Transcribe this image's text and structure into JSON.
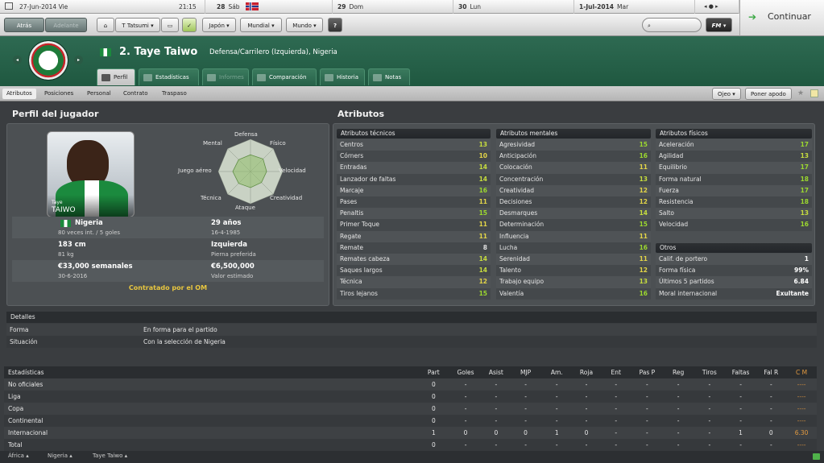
{
  "date_bar": {
    "current_date": "27-Jun-2014 Vie",
    "time": "21:15",
    "d1_day": "28",
    "d1_name": "Sáb",
    "d2_day": "29",
    "d2_name": "Dom",
    "d3_day": "30",
    "d3_name": "Lun",
    "d4_day": "1-Jul-2014",
    "d4_name": "Mar"
  },
  "toolbar": {
    "back": "Atrás",
    "forward": "Adelante",
    "manager": "T Tatsumi",
    "menu1": "Japón",
    "menu2": "Mundial",
    "menu3": "Mundo",
    "help": "?",
    "continue": "Continuar",
    "logo": "FM"
  },
  "player": {
    "title": "2. Taye Taiwo",
    "subtitle": "Defensa/Carrilero (Izquierda), Nigeria",
    "card_first": "Taye",
    "card_last": "TAIWO",
    "nation": "Nigeria",
    "caps": "80 veces int. / 5 goles",
    "age": "29 años",
    "dob": "16-4-1985",
    "height": "183 cm",
    "weight": "81 kg",
    "foot": "Izquierda",
    "foot_label": "Pierna preferida",
    "wage": "€33,000 semanales",
    "contract": "30-6-2016",
    "value": "€6,500,000",
    "value_label": "Valor estimado",
    "contracted": "Contratado por el OM"
  },
  "tabs": [
    "Perfil",
    "Estadísticas",
    "Informes",
    "Comparación",
    "Historia",
    "Notas"
  ],
  "subnav": {
    "items": [
      "Atributos",
      "Posiciones",
      "Personal",
      "Contrato",
      "Traspaso"
    ],
    "btn_eye": "Ojeo",
    "btn_status": "Poner apodo"
  },
  "sections": {
    "profile": "Perfil del jugador",
    "attributes": "Atributos"
  },
  "radar": {
    "labels": [
      "Defensa",
      "Físico",
      "Velocidad",
      "Creatividad",
      "Ataque",
      "Técnica",
      "Juego aéreo",
      "Mental"
    ],
    "values": [
      0.52,
      0.55,
      0.5,
      0.48,
      0.5,
      0.52,
      0.55,
      0.52
    ]
  },
  "attrs": {
    "tech_title": "Atributos técnicos",
    "tech": [
      {
        "n": "Centros",
        "v": "13"
      },
      {
        "n": "Córners",
        "v": "10"
      },
      {
        "n": "Entradas",
        "v": "14"
      },
      {
        "n": "Lanzador de faltas",
        "v": "14"
      },
      {
        "n": "Marcaje",
        "v": "16"
      },
      {
        "n": "Pases",
        "v": "11"
      },
      {
        "n": "Penaltis",
        "v": "15"
      },
      {
        "n": "Primer Toque",
        "v": "11"
      },
      {
        "n": "Regate",
        "v": "11"
      },
      {
        "n": "Remate",
        "v": "8"
      },
      {
        "n": "Remates cabeza",
        "v": "14"
      },
      {
        "n": "Saques largos",
        "v": "14"
      },
      {
        "n": "Técnica",
        "v": "12"
      },
      {
        "n": "Tiros lejanos",
        "v": "15"
      }
    ],
    "mental_title": "Atributos mentales",
    "mental": [
      {
        "n": "Agresividad",
        "v": "15"
      },
      {
        "n": "Anticipación",
        "v": "16"
      },
      {
        "n": "Colocación",
        "v": "11"
      },
      {
        "n": "Concentración",
        "v": "13"
      },
      {
        "n": "Creatividad",
        "v": "12"
      },
      {
        "n": "Decisiones",
        "v": "12"
      },
      {
        "n": "Desmarques",
        "v": "14"
      },
      {
        "n": "Determinación",
        "v": "15"
      },
      {
        "n": "Influencia",
        "v": "11"
      },
      {
        "n": "Lucha",
        "v": "16"
      },
      {
        "n": "Serenidad",
        "v": "11"
      },
      {
        "n": "Talento",
        "v": "12"
      },
      {
        "n": "Trabajo equipo",
        "v": "13"
      },
      {
        "n": "Valentía",
        "v": "16"
      }
    ],
    "phys_title": "Atributos físicos",
    "phys": [
      {
        "n": "Aceleración",
        "v": "17"
      },
      {
        "n": "Agilidad",
        "v": "13"
      },
      {
        "n": "Equilibrio",
        "v": "17"
      },
      {
        "n": "Forma natural",
        "v": "18"
      },
      {
        "n": "Fuerza",
        "v": "17"
      },
      {
        "n": "Resistencia",
        "v": "18"
      },
      {
        "n": "Salto",
        "v": "13"
      },
      {
        "n": "Velocidad",
        "v": "16"
      }
    ],
    "other_title": "Otros",
    "other": [
      {
        "n": "Calif. de portero",
        "v": "1"
      },
      {
        "n": "Forma física",
        "v": "99%"
      },
      {
        "n": "Últimos 5 partidos",
        "v": "6.84"
      },
      {
        "n": "Moral internacional",
        "v": "Exultante"
      }
    ]
  },
  "details": {
    "title": "Detalles",
    "rows": [
      {
        "k": "Forma",
        "v": "En forma para el partido"
      },
      {
        "k": "Situación",
        "v": "Con la selección de Nigeria"
      }
    ]
  },
  "stats": {
    "headers": [
      "Estadísticas",
      "Part",
      "Goles",
      "Asist",
      "MJP",
      "Am.",
      "Roja",
      "Ent",
      "Pas P",
      "Reg",
      "Tiros",
      "Faltas",
      "Fal R",
      "C M"
    ],
    "rows": [
      [
        "No oficiales",
        "0",
        "-",
        "-",
        "-",
        "-",
        "-",
        "-",
        "-",
        "-",
        "-",
        "-",
        "-",
        "----"
      ],
      [
        "Liga",
        "0",
        "-",
        "-",
        "-",
        "-",
        "-",
        "-",
        "-",
        "-",
        "-",
        "-",
        "-",
        "----"
      ],
      [
        "Copa",
        "0",
        "-",
        "-",
        "-",
        "-",
        "-",
        "-",
        "-",
        "-",
        "-",
        "-",
        "-",
        "----"
      ],
      [
        "Continental",
        "0",
        "-",
        "-",
        "-",
        "-",
        "-",
        "-",
        "-",
        "-",
        "-",
        "-",
        "-",
        "----"
      ],
      [
        "Internacional",
        "1",
        "0",
        "0",
        "0",
        "1",
        "0",
        "-",
        "-",
        "-",
        "-",
        "1",
        "0",
        "6.30"
      ],
      [
        "Total",
        "0",
        "-",
        "-",
        "-",
        "-",
        "-",
        "-",
        "-",
        "-",
        "-",
        "-",
        "-",
        "----"
      ]
    ]
  },
  "footer": [
    "África",
    "Nigeria",
    "Taye Taiwo"
  ]
}
